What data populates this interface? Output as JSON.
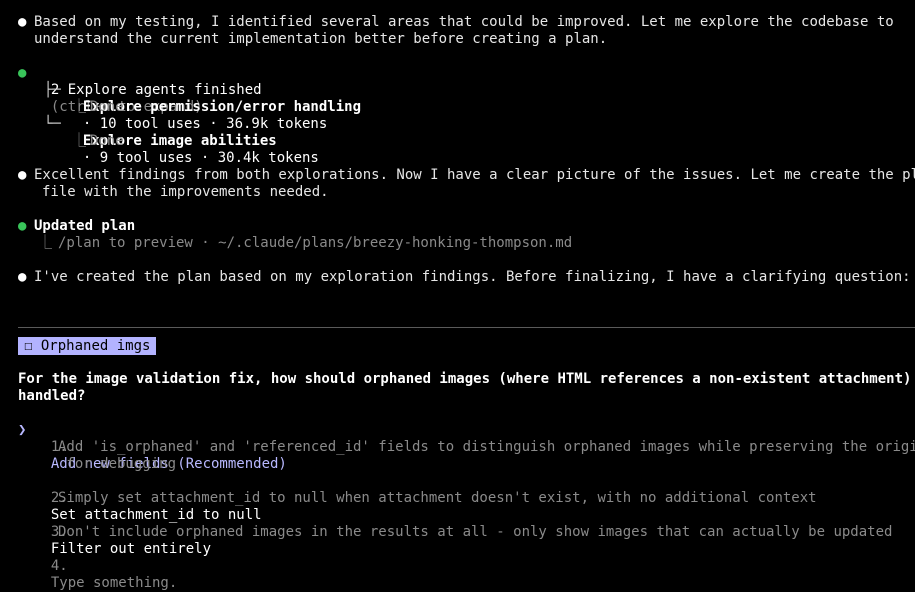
{
  "messages": {
    "intro": {
      "bullet": "●",
      "line1": "Based on my testing, I identified several areas that could be improved. Let me explore the codebase to",
      "line2": "understand the current implementation better before creating a plan."
    },
    "agents": {
      "bullet": "●",
      "title": "2 Explore agents finished",
      "hint": "(ctrl+o to expand)",
      "items": [
        {
          "tree": "├─",
          "name": "Explore permission/error handling",
          "stats": "· 10 tool uses · 36.9k tokens",
          "status_tree": "⎿",
          "status": "Done"
        },
        {
          "tree": "└─",
          "name": "Explore image abilities",
          "stats": "· 9 tool uses · 30.4k tokens",
          "status_tree": "⎿",
          "status": "Done"
        }
      ]
    },
    "findings": {
      "bullet": "●",
      "line1": "Excellent findings from both explorations. Now I have a clear picture of the issues. Let me create the plan",
      "line2": "file with the improvements needed."
    },
    "plan": {
      "bullet": "●",
      "title": "Updated plan",
      "tree": "⎿",
      "text": "/plan to preview · ~/.claude/plans/breezy-honking-thompson.md"
    },
    "question_intro": {
      "bullet": "●",
      "text": "I've created the plan based on my exploration findings. Before finalizing, I have a clarifying question:"
    }
  },
  "question": {
    "tag_checkbox": "☐",
    "tag": "Orphaned imgs",
    "prompt_line1": "For the image validation fix, how should orphaned images (where HTML references a non-existent attachment) be",
    "prompt_line2": "handled?",
    "cursor": "❯",
    "options": [
      {
        "number": "1.",
        "label": "Add new fields (Recommended)",
        "desc1": "Add 'is_orphaned' and 'referenced_id' fields to distinguish orphaned images while preserving the original I",
        "desc2": " for debugging"
      },
      {
        "number": "2.",
        "label": "Set attachment_id to null",
        "desc1": "Simply set attachment_id to null when attachment doesn't exist, with no additional context"
      },
      {
        "number": "3.",
        "label": "Filter out entirely",
        "desc1": "Don't include orphaned images in the results at all - only show images that can actually be updated"
      },
      {
        "number": "4.",
        "label": "Type something."
      }
    ]
  }
}
